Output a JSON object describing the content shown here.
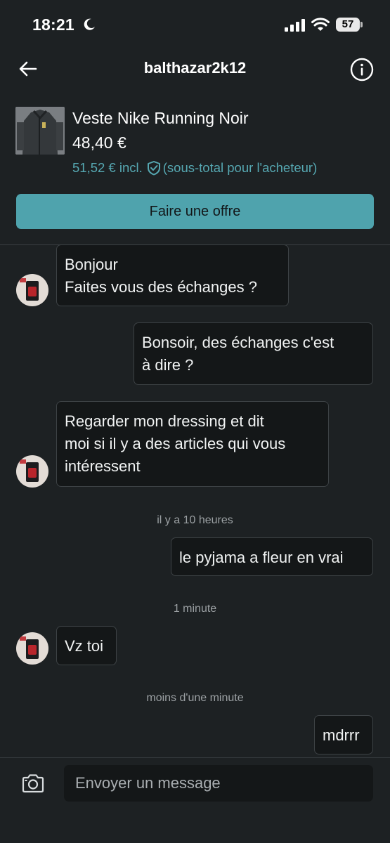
{
  "status_bar": {
    "time": "18:21",
    "battery": "57"
  },
  "header": {
    "title": "balthazar2k12"
  },
  "product": {
    "title": "Veste Nike Running Noir",
    "price": "48,40 €",
    "price_incl": "51,52 € incl.",
    "price_incl_note": "(sous-total pour l'acheteur)"
  },
  "offer_button": {
    "label": "Faire une offre"
  },
  "messages": [
    {
      "sender": "other",
      "lines": [
        "Bonjour",
        "Faites vous des échanges ?"
      ]
    },
    {
      "sender": "me",
      "lines": [
        "Bonsoir, des échanges c'est",
        "à dire ?"
      ]
    },
    {
      "sender": "other",
      "lines": [
        "Regarder mon dressing et dit",
        "moi si il y a des articles qui vous",
        "intéressent"
      ]
    },
    {
      "sender": "me",
      "lines": [
        "le pyjama a fleur en vrai"
      ]
    },
    {
      "sender": "other",
      "lines": [
        "Vz toi"
      ]
    },
    {
      "sender": "me",
      "lines": [
        "mdrrr"
      ]
    }
  ],
  "timestamps": [
    "il y a 10 heures",
    "1 minute",
    "moins d'une minute"
  ],
  "composer": {
    "placeholder": "Envoyer un message"
  },
  "colors": {
    "background": "#1d2123",
    "accent": "#4fa3ad",
    "accent_text": "#56a8b2",
    "bubble": "#141718"
  }
}
